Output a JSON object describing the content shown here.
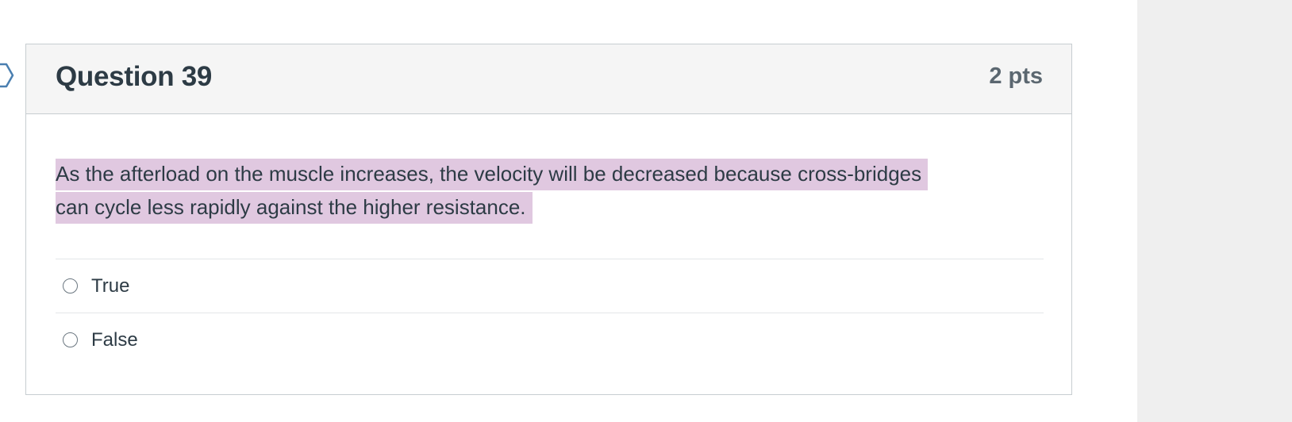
{
  "question": {
    "title": "Question 39",
    "points": "2 pts",
    "text_line1": "As the afterload on the muscle increases, the velocity will be decreased because cross-bridges",
    "text_line2": "can cycle less rapidly against the higher resistance."
  },
  "answers": [
    {
      "label": "True",
      "selected": false
    },
    {
      "label": "False",
      "selected": false
    }
  ],
  "icons": {
    "flag": "flag-marker-icon",
    "radio": "radio-unselected-icon"
  },
  "colors": {
    "header_bg": "#f5f5f5",
    "highlight": "#e0c8e0",
    "sidebar_bg": "#efefef",
    "text": "#2d3b45",
    "points_text": "#5b6770"
  }
}
